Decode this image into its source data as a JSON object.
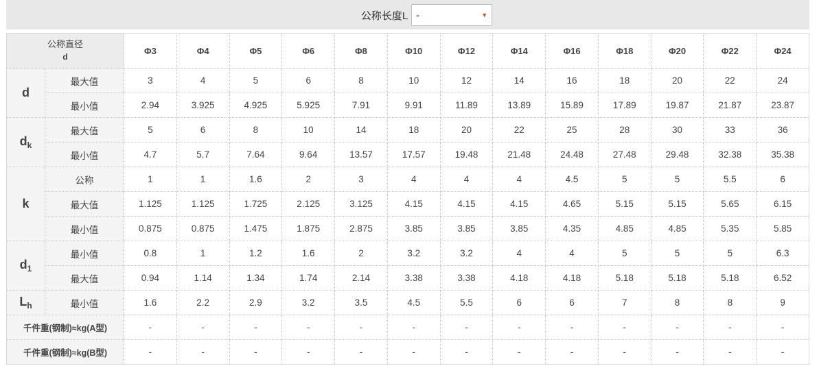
{
  "filter": {
    "label": "公称长度L",
    "selected": "-",
    "caret_icon": "dropdown-caret-icon"
  },
  "header": {
    "corner_line1": "公称直径",
    "corner_line2": "d",
    "columns": [
      "Φ3",
      "Φ4",
      "Φ5",
      "Φ6",
      "Φ8",
      "Φ10",
      "Φ12",
      "Φ14",
      "Φ16",
      "Φ18",
      "Φ20",
      "Φ22",
      "Φ24"
    ]
  },
  "groups": [
    {
      "symbol": "d",
      "subscript": "",
      "rows": [
        {
          "label": "最大值",
          "values": [
            "3",
            "4",
            "5",
            "6",
            "8",
            "10",
            "12",
            "14",
            "16",
            "18",
            "20",
            "22",
            "24"
          ]
        },
        {
          "label": "最小值",
          "values": [
            "2.94",
            "3.925",
            "4.925",
            "5.925",
            "7.91",
            "9.91",
            "11.89",
            "13.89",
            "15.89",
            "17.89",
            "19.87",
            "21.87",
            "23.87"
          ]
        }
      ]
    },
    {
      "symbol": "d",
      "subscript": "k",
      "rows": [
        {
          "label": "最大值",
          "values": [
            "5",
            "6",
            "8",
            "10",
            "14",
            "18",
            "20",
            "22",
            "25",
            "28",
            "30",
            "33",
            "36"
          ]
        },
        {
          "label": "最小值",
          "values": [
            "4.7",
            "5.7",
            "7.64",
            "9.64",
            "13.57",
            "17.57",
            "19.48",
            "21.48",
            "24.48",
            "27.48",
            "29.48",
            "32.38",
            "35.38"
          ]
        }
      ]
    },
    {
      "symbol": "k",
      "subscript": "",
      "rows": [
        {
          "label": "公称",
          "values": [
            "1",
            "1",
            "1.6",
            "2",
            "3",
            "4",
            "4",
            "4",
            "4.5",
            "5",
            "5",
            "5.5",
            "6"
          ]
        },
        {
          "label": "最大值",
          "values": [
            "1.125",
            "1.125",
            "1.725",
            "2.125",
            "3.125",
            "4.15",
            "4.15",
            "4.15",
            "4.65",
            "5.15",
            "5.15",
            "5.65",
            "6.15"
          ]
        },
        {
          "label": "最小值",
          "values": [
            "0.875",
            "0.875",
            "1.475",
            "1.875",
            "2.875",
            "3.85",
            "3.85",
            "3.85",
            "4.35",
            "4.85",
            "4.85",
            "5.35",
            "5.85"
          ]
        }
      ]
    },
    {
      "symbol": "d",
      "subscript": "1",
      "rows": [
        {
          "label": "最小值",
          "values": [
            "0.8",
            "1",
            "1.2",
            "1.6",
            "2",
            "3.2",
            "3.2",
            "4",
            "4",
            "5",
            "5",
            "5",
            "6.3"
          ]
        },
        {
          "label": "最大值",
          "values": [
            "0.94",
            "1.14",
            "1.34",
            "1.74",
            "2.14",
            "3.38",
            "3.38",
            "4.18",
            "4.18",
            "5.18",
            "5.18",
            "5.18",
            "6.52"
          ]
        }
      ]
    },
    {
      "symbol": "L",
      "subscript": "h",
      "rows": [
        {
          "label": "最小值",
          "values": [
            "1.6",
            "2.2",
            "2.9",
            "3.2",
            "3.5",
            "4.5",
            "5.5",
            "6",
            "6",
            "7",
            "8",
            "8",
            "9"
          ]
        }
      ]
    }
  ],
  "weight_rows": [
    {
      "label": "千件重(钢制)≈kg(A型)",
      "values": [
        "-",
        "-",
        "-",
        "-",
        "-",
        "-",
        "-",
        "-",
        "-",
        "-",
        "-",
        "-",
        "-"
      ]
    },
    {
      "label": "千件重(钢制)≈kg(B型)",
      "values": [
        "-",
        "-",
        "-",
        "-",
        "-",
        "-",
        "-",
        "-",
        "-",
        "-",
        "-",
        "-",
        "-"
      ]
    }
  ],
  "colors": {
    "accent_blue": "#1a5fb4",
    "dash_red": "#e8431c",
    "header_bg": "#ececec",
    "label_bg": "#f4f4f4"
  }
}
